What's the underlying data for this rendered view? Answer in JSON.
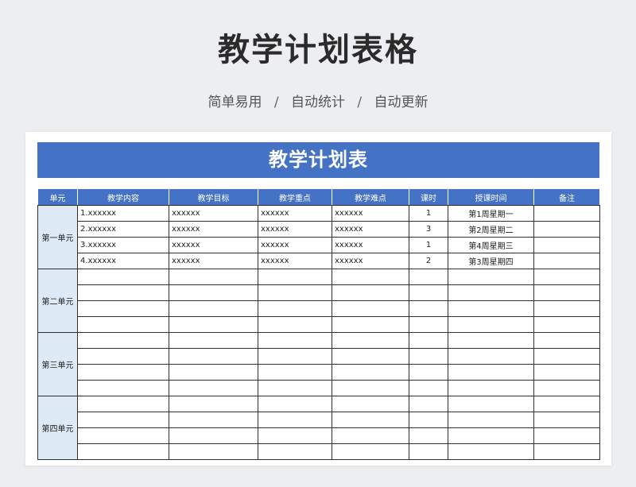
{
  "header": {
    "title": "教学计划表格",
    "tags": [
      "简单易用",
      "自动统计",
      "自动更新"
    ],
    "separator": "/"
  },
  "sheet": {
    "banner": "教学计划表",
    "columns": [
      "单元",
      "教学内容",
      "教学目标",
      "教学重点",
      "教学难点",
      "课时",
      "授课时间",
      "备注"
    ],
    "units": [
      {
        "name": "第一单元",
        "rows": [
          {
            "content": "1.xxxxxx",
            "goal": "xxxxxx",
            "focus": "xxxxxx",
            "difficulty": "xxxxxx",
            "hours": "1",
            "time": "第1周星期一",
            "note": ""
          },
          {
            "content": "2.xxxxxx",
            "goal": "xxxxxx",
            "focus": "xxxxxx",
            "difficulty": "xxxxxx",
            "hours": "3",
            "time": "第2周星期二",
            "note": ""
          },
          {
            "content": "3.xxxxxx",
            "goal": "xxxxxx",
            "focus": "xxxxxx",
            "difficulty": "xxxxxx",
            "hours": "1",
            "time": "第4周星期三",
            "note": ""
          },
          {
            "content": "4.xxxxxx",
            "goal": "xxxxxx",
            "focus": "xxxxxx",
            "difficulty": "xxxxxx",
            "hours": "2",
            "time": "第3周星期四",
            "note": ""
          }
        ]
      },
      {
        "name": "第二单元",
        "rows": [
          {
            "content": "",
            "goal": "",
            "focus": "",
            "difficulty": "",
            "hours": "",
            "time": "",
            "note": ""
          },
          {
            "content": "",
            "goal": "",
            "focus": "",
            "difficulty": "",
            "hours": "",
            "time": "",
            "note": ""
          },
          {
            "content": "",
            "goal": "",
            "focus": "",
            "difficulty": "",
            "hours": "",
            "time": "",
            "note": ""
          },
          {
            "content": "",
            "goal": "",
            "focus": "",
            "difficulty": "",
            "hours": "",
            "time": "",
            "note": ""
          }
        ]
      },
      {
        "name": "第三单元",
        "rows": [
          {
            "content": "",
            "goal": "",
            "focus": "",
            "difficulty": "",
            "hours": "",
            "time": "",
            "note": ""
          },
          {
            "content": "",
            "goal": "",
            "focus": "",
            "difficulty": "",
            "hours": "",
            "time": "",
            "note": ""
          },
          {
            "content": "",
            "goal": "",
            "focus": "",
            "difficulty": "",
            "hours": "",
            "time": "",
            "note": ""
          },
          {
            "content": "",
            "goal": "",
            "focus": "",
            "difficulty": "",
            "hours": "",
            "time": "",
            "note": ""
          }
        ]
      },
      {
        "name": "第四单元",
        "rows": [
          {
            "content": "",
            "goal": "",
            "focus": "",
            "difficulty": "",
            "hours": "",
            "time": "",
            "note": ""
          },
          {
            "content": "",
            "goal": "",
            "focus": "",
            "difficulty": "",
            "hours": "",
            "time": "",
            "note": ""
          },
          {
            "content": "",
            "goal": "",
            "focus": "",
            "difficulty": "",
            "hours": "",
            "time": "",
            "note": ""
          },
          {
            "content": "",
            "goal": "",
            "focus": "",
            "difficulty": "",
            "hours": "",
            "time": "",
            "note": ""
          }
        ]
      }
    ]
  },
  "colors": {
    "accent": "#4472c4",
    "unit_cell_bg": "#dde9f5",
    "page_bg": "#eceef1"
  }
}
